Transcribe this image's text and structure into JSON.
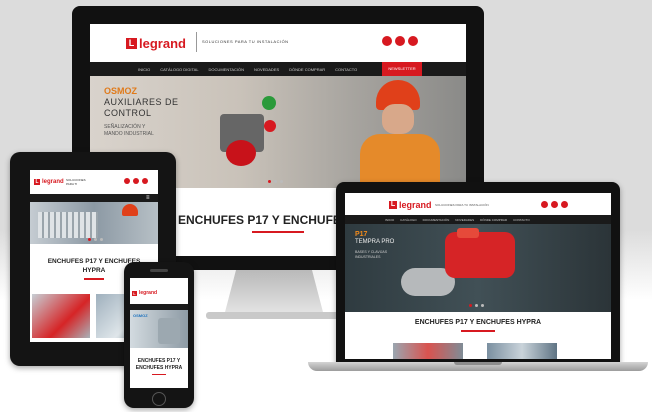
{
  "brand": {
    "logo_text": "legrand",
    "logo_mark": "L",
    "tagline": "SOLUCIONES PARA TU INSTALACIÓN"
  },
  "colors": {
    "brand_red": "#d71920",
    "nav_dark": "#1a1a1a",
    "device_black": "#111111"
  },
  "desktop": {
    "nav_items": [
      "INICIO",
      "CATÁLOGO DIGITAL",
      "DOCUMENTACIÓN",
      "NOVEDADES",
      "DÓNDE COMPRAR",
      "CONTACTO"
    ],
    "nav_cta": "NEWSLETTER",
    "hero_title": "OSMOZ",
    "hero_subtitle_1": "AUXILIARES DE",
    "hero_subtitle_2": "CONTROL",
    "hero_text_1": "SEÑALIZACIÓN Y",
    "hero_text_2": "MANDO INDUSTRIAL",
    "section_title": "ENCHUFES P17 Y ENCHUFES"
  },
  "laptop": {
    "nav_items": [
      "INICIO",
      "CATÁLOGO",
      "DOCUMENTACIÓN",
      "NOVEDADES",
      "DÓNDE COMPRAR",
      "CONTACTO"
    ],
    "hero_title": "P17",
    "hero_subtitle": "TEMPRA PRO",
    "hero_text_1": "BASES Y CLAVIJAS",
    "hero_text_2": "INDUSTRIALES",
    "section_title": "ENCHUFES P17 Y ENCHUFES HYPRA"
  },
  "tablet": {
    "header_text_1": "SOLUCIONES",
    "header_text_2": "PARA TI",
    "section_title_1": "ENCHUFES P17 Y ENCHUFES",
    "section_title_2": "HYPRA"
  },
  "phone": {
    "hero_label": "OSMOZ",
    "section_title_1": "ENCHUFES P17 Y",
    "section_title_2": "ENCHUFES HYPRA"
  },
  "icons": [
    "facebook-icon",
    "twitter-icon",
    "linkedin-icon"
  ]
}
